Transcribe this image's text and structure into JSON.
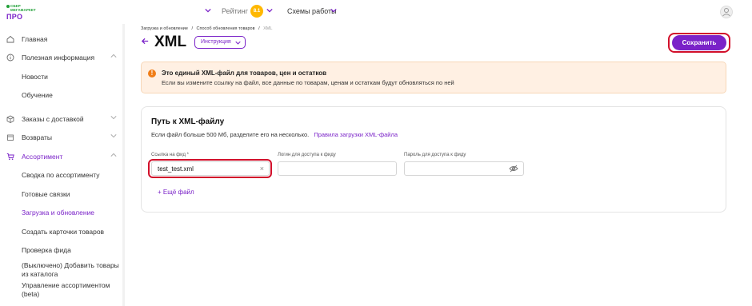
{
  "header": {
    "logo_line1": "СБЕР МЕГАМАРКЕТ",
    "logo_line2": "ПРО",
    "rating_label": "Рейтинг",
    "rating_value": "8.1",
    "schemes_label": "Схемы работы",
    "icons": {
      "chevron": "chevron-down-icon",
      "avatar": "user-icon"
    }
  },
  "sidebar": {
    "items": [
      {
        "label": "Главная",
        "icon": "home-icon"
      },
      {
        "label": "Полезная информация",
        "icon": "info-icon"
      },
      {
        "label": "Новости"
      },
      {
        "label": "Обучение"
      },
      {
        "label": "Заказы с доставкой",
        "icon": "box-icon"
      },
      {
        "label": "Возвраты",
        "icon": "return-icon"
      },
      {
        "label": "Ассортимент",
        "icon": "cart-icon"
      },
      {
        "label": "Сводка по ассортименту"
      },
      {
        "label": "Готовые связки"
      },
      {
        "label": "Загрузка и обновление"
      },
      {
        "label": "Создать карточки товаров"
      },
      {
        "label": "Проверка фида"
      },
      {
        "label": "(Выключено) Добавить товары из каталога"
      },
      {
        "label": "Управление ассортиментом (beta)"
      }
    ],
    "accent_color": "#7a22c8"
  },
  "breadcrumb": {
    "part1": "Загрузка и обновление",
    "sep": "/",
    "part2": "Способ обновления товаров",
    "part3": "XML"
  },
  "page": {
    "title": "XML",
    "instructions_label": "Инструкция",
    "save_label": "Сохранить"
  },
  "alert": {
    "title": "Это единый XML-файл для товаров, цен и остатков",
    "text": "Если вы измените ссылку на файл, все данные по товарам, ценам и остаткам будут обновляться по ней",
    "icon": "warning-icon"
  },
  "card": {
    "title": "Путь к XML-файлу",
    "description": "Если файл больше 500 Мб, разделите его на несколько.",
    "rules_link": "Правила загрузки XML-файла",
    "fields": {
      "feed_label": "Ссылка на фид *",
      "feed_value": "test_test.xml",
      "login_label": "Логин для доступа к фиду",
      "login_value": "",
      "password_label": "Пароль для доступа к фиду",
      "password_value": ""
    },
    "add_more_label": "+ Ещё файл"
  },
  "colors": {
    "accent": "#7a22c8",
    "highlight": "#d2102b",
    "alert_bg": "#fff0e3",
    "alert_icon": "#f07d17"
  }
}
